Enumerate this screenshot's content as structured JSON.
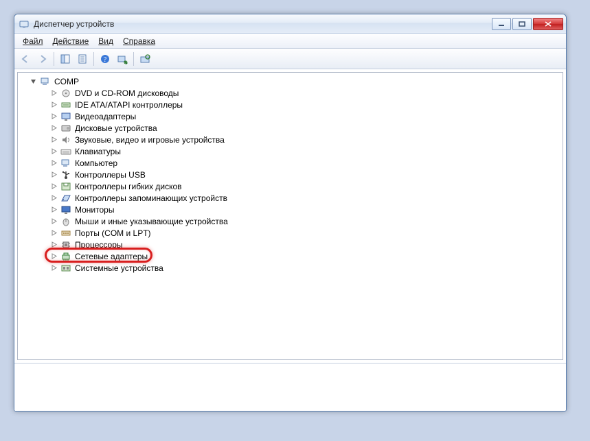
{
  "title": "Диспетчер устройств",
  "menu": {
    "file": "Файл",
    "action": "Действие",
    "view": "Вид",
    "help": "Справка"
  },
  "tree": {
    "root": "COMP",
    "items": [
      {
        "label": "DVD и CD-ROM дисководы",
        "icon": "disc"
      },
      {
        "label": "IDE ATA/ATAPI контроллеры",
        "icon": "ide"
      },
      {
        "label": "Видеоадаптеры",
        "icon": "display"
      },
      {
        "label": "Дисковые устройства",
        "icon": "disk"
      },
      {
        "label": "Звуковые, видео и игровые устройства",
        "icon": "sound"
      },
      {
        "label": "Клавиатуры",
        "icon": "keyboard"
      },
      {
        "label": "Компьютер",
        "icon": "computer"
      },
      {
        "label": "Контроллеры USB",
        "icon": "usb"
      },
      {
        "label": "Контроллеры гибких дисков",
        "icon": "floppy-ctrl"
      },
      {
        "label": "Контроллеры запоминающих устройств",
        "icon": "storage"
      },
      {
        "label": "Мониторы",
        "icon": "monitor"
      },
      {
        "label": "Мыши и иные указывающие устройства",
        "icon": "mouse"
      },
      {
        "label": "Порты (COM и LPT)",
        "icon": "port"
      },
      {
        "label": "Процессоры",
        "icon": "cpu"
      },
      {
        "label": "Сетевые адаптеры",
        "icon": "network",
        "highlighted": true
      },
      {
        "label": "Системные устройства",
        "icon": "system"
      }
    ]
  }
}
